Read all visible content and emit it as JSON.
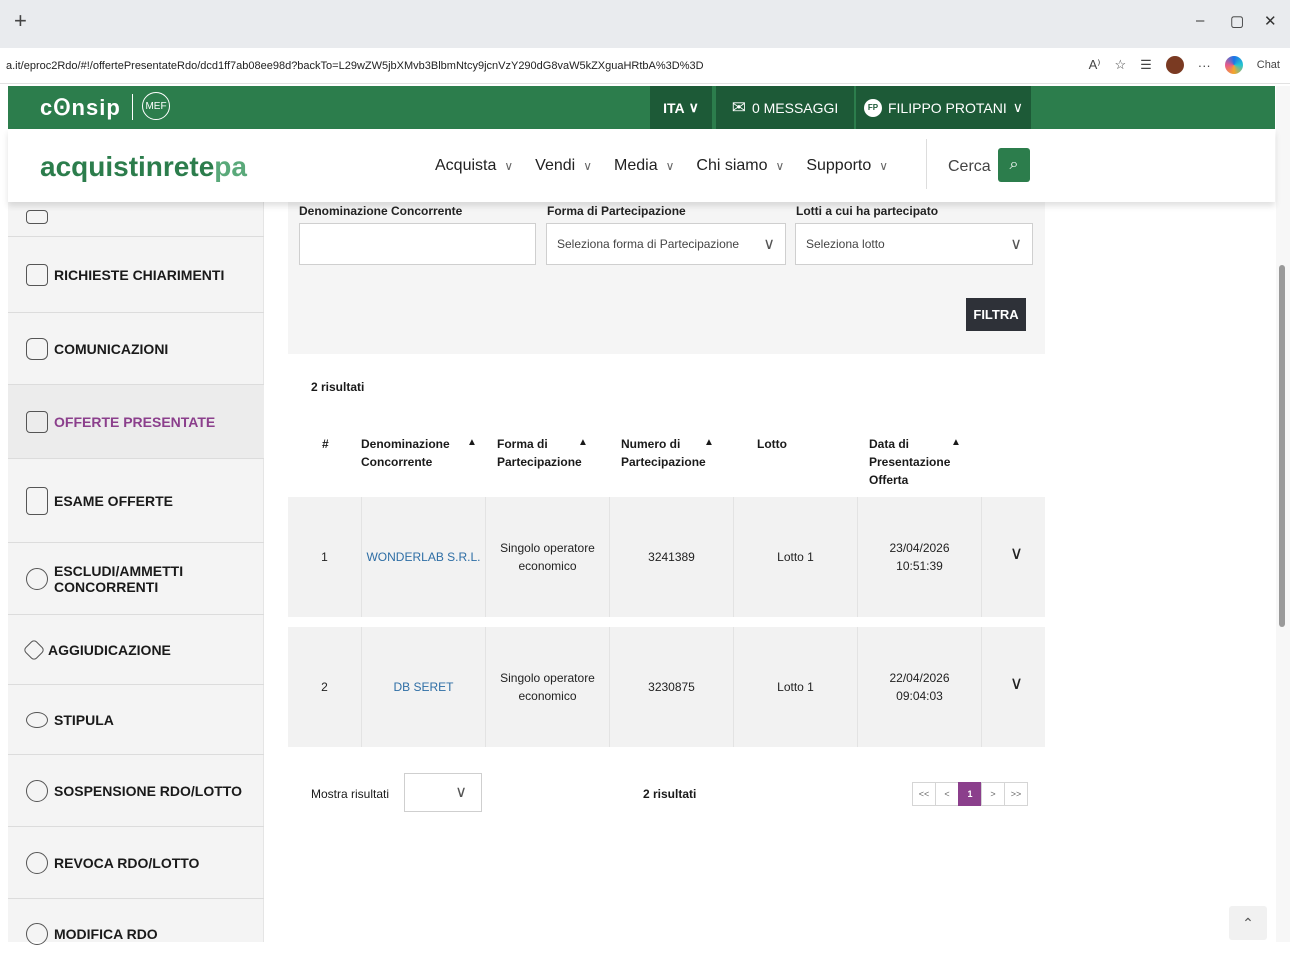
{
  "browser": {
    "new_tab": "+",
    "url": "a.it/eproc2Rdo/#!/offertePresentateRdo/dcd1ff7ab08ee98d?backTo=L29wZW5jbXMvb3BlbmNtcy9jcnVzY290dG8vaW5kZXguaHRtbA%3D%3D",
    "chat_label": "Chat",
    "win_min": "–",
    "win_restore": "▢",
    "win_close": "✕"
  },
  "header": {
    "logo_text": "cꙨnsip",
    "mef_text": "MEF",
    "lang": "ITA",
    "messages": "0 MESSAGGI",
    "user_initials": "FP",
    "user_name": "FILIPPO PROTANI"
  },
  "nav": {
    "brand_main": "acquistinrete",
    "brand_pa": "pa",
    "menu": [
      "Acquista",
      "Vendi",
      "Media",
      "Chi siamo",
      "Supporto"
    ],
    "search_label": "Cerca"
  },
  "sidebar": {
    "items": [
      "RICHIESTE CHIARIMENTI",
      "COMUNICAZIONI",
      "OFFERTE PRESENTATE",
      "ESAME OFFERTE",
      "ESCLUDI/AMMETTI CONCORRENTI",
      "AGGIUDICAZIONE",
      "STIPULA",
      "SOSPENSIONE RDO/LOTTO",
      "REVOCA RDO/LOTTO",
      "MODIFICA RDO"
    ],
    "active": "OFFERTE PRESENTATE"
  },
  "filters": {
    "label_denominazione": "Denominazione Concorrente",
    "label_forma": "Forma di Partecipazione",
    "label_lotti": "Lotti a cui ha partecipato",
    "denominazione_value": "",
    "forma_placeholder": "Seleziona forma di Partecipazione",
    "lotto_placeholder": "Seleziona lotto",
    "filtra_button": "FILTRA"
  },
  "results": {
    "count_text": "2 risultati",
    "headers": {
      "num": "#",
      "denominazione": "Denominazione Concorrente",
      "forma": "Forma di Partecipazione",
      "numero": "Numero di Partecipazione",
      "lotto": "Lotto",
      "data": "Data di Presentazione Offerta"
    },
    "rows": [
      {
        "n": "1",
        "name": "WONDERLAB S.R.L.",
        "forma": "Singolo operatore economico",
        "numero": "3241389",
        "lotto": "Lotto 1",
        "date": "23/04/2026",
        "time": "10:51:39"
      },
      {
        "n": "2",
        "name": "DB SERET",
        "forma": "Singolo operatore economico",
        "numero": "3230875",
        "lotto": "Lotto 1",
        "date": "22/04/2026",
        "time": "09:04:03"
      }
    ]
  },
  "footer": {
    "mostra_label": "Mostra risultati",
    "count_text": "2 risultati",
    "pager": [
      "<<",
      "<",
      "1",
      ">",
      ">>"
    ]
  },
  "colors": {
    "brand_green": "#2c7d4c",
    "dark_green": "#1d5a37",
    "accent_purple": "#8b3f8c",
    "link_blue": "#2e6ea5"
  }
}
